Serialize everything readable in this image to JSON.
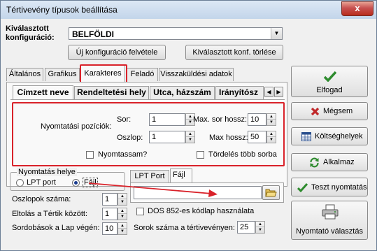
{
  "window": {
    "title": "Tértivevény típusok beállítása",
    "close_glyph": "x"
  },
  "config": {
    "label_line1": "Kiválasztott",
    "label_line2": "konfiguráció:",
    "value": "BELFÖLDI",
    "new_button": "Új konfiguráció felvétele",
    "delete_button": "Kiválasztott konf. törlése"
  },
  "tabs": [
    "Általános",
    "Grafikus",
    "Karakteres",
    "Feladó",
    "Visszaküldési adatok"
  ],
  "active_tab": "Karakteres",
  "subtabs": [
    "Címzett neve",
    "Rendeltetési hely",
    "Utca, házszám",
    "Irányítósz"
  ],
  "position": {
    "group_label": "Nyomtatási pozíciók:",
    "row_label": "Sor:",
    "row_value": "1",
    "col_label": "Oszlop:",
    "col_value": "1",
    "max_row_label": "Max. sor hossz:",
    "max_row_value": "10",
    "max_len_label": "Max hossz:",
    "max_len_value": "50",
    "print_check": "Nyomtassam?",
    "wrap_check": "Tördelés több sorba"
  },
  "print_place": {
    "label": "Nyomtatás helye",
    "options": [
      "LPT port",
      "Fájl"
    ],
    "selected": "Fájl"
  },
  "output_tabs": [
    "LPT Port",
    "Fájl"
  ],
  "file_path": "",
  "settings": {
    "columns_label": "Oszlopok száma:",
    "columns_value": "1",
    "offset_label": "Eltolás a Tértik között:",
    "offset_value": "1",
    "breaks_label": "Sordobások a Lap végén:",
    "breaks_value": "10",
    "dos_label": "DOS 852-es kódlap használata",
    "rows_label": "Sorok száma a tértivevényen:",
    "rows_value": "25"
  },
  "buttons": {
    "save": "Elfogad",
    "cancel": "Mégsem",
    "cost": "Költséghelyek",
    "apply": "Alkalmaz",
    "test": "Teszt nyomtatás",
    "printer": "Nyomtató választás"
  },
  "colors": {
    "highlight": "#d9222a",
    "check_green": "#2e8b2e",
    "cancel_red": "#c0282a"
  }
}
